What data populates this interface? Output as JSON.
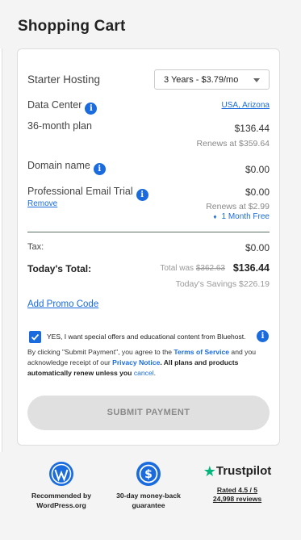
{
  "page": {
    "title": "Shopping Cart"
  },
  "cart": {
    "plan_name": "Starter Hosting",
    "term_select": "3 Years - $3.79/mo",
    "data_center_label": "Data Center",
    "data_center_value": "USA, Arizona",
    "plan_term": "36-month plan",
    "plan_price": "$136.44",
    "plan_renews": "Renews at $359.64",
    "domain_label": "Domain name",
    "domain_price": "$0.00",
    "email_label": "Professional Email Trial",
    "email_price": "$0.00",
    "email_remove": "Remove",
    "email_renews": "Renews at $2.99",
    "email_free": "1 Month Free",
    "tax_label": "Tax:",
    "tax_value": "$0.00",
    "total_label": "Today's Total:",
    "total_was_prefix": "Total was",
    "total_was_value": "$362.63",
    "total_value": "$136.44",
    "savings": "Today's Savings $226.19",
    "promo_link": "Add Promo Code",
    "optin_checked": true,
    "optin_text": "YES, I want special offers and educational content from Bluehost.",
    "legal": {
      "part1": "By clicking \"Submit Payment\", you agree to the ",
      "terms_link": "Terms of Service",
      "part2": " and you acknowledge receipt of our ",
      "privacy_link": "Privacy Notice",
      "part3": ". All plans and products automatically renew unless you ",
      "cancel_link": "cancel",
      "part4": "."
    },
    "submit_label": "SUBMIT PAYMENT"
  },
  "badges": {
    "wordpress": {
      "line1": "Recommended by",
      "line2": "WordPress.org",
      "icon": "wordpress-icon"
    },
    "moneyback": {
      "line1": "30-day money-back",
      "line2": "guarantee",
      "icon": "money-back-icon"
    },
    "trustpilot": {
      "brand": "Trustpilot",
      "rating": "Rated 4.5 / 5",
      "reviews": "24,998 reviews",
      "icon": "star-icon"
    }
  },
  "colors": {
    "accent": "#196bde",
    "trustpilot_green": "#00b67a",
    "button_disabled": "#e0e0e0"
  }
}
